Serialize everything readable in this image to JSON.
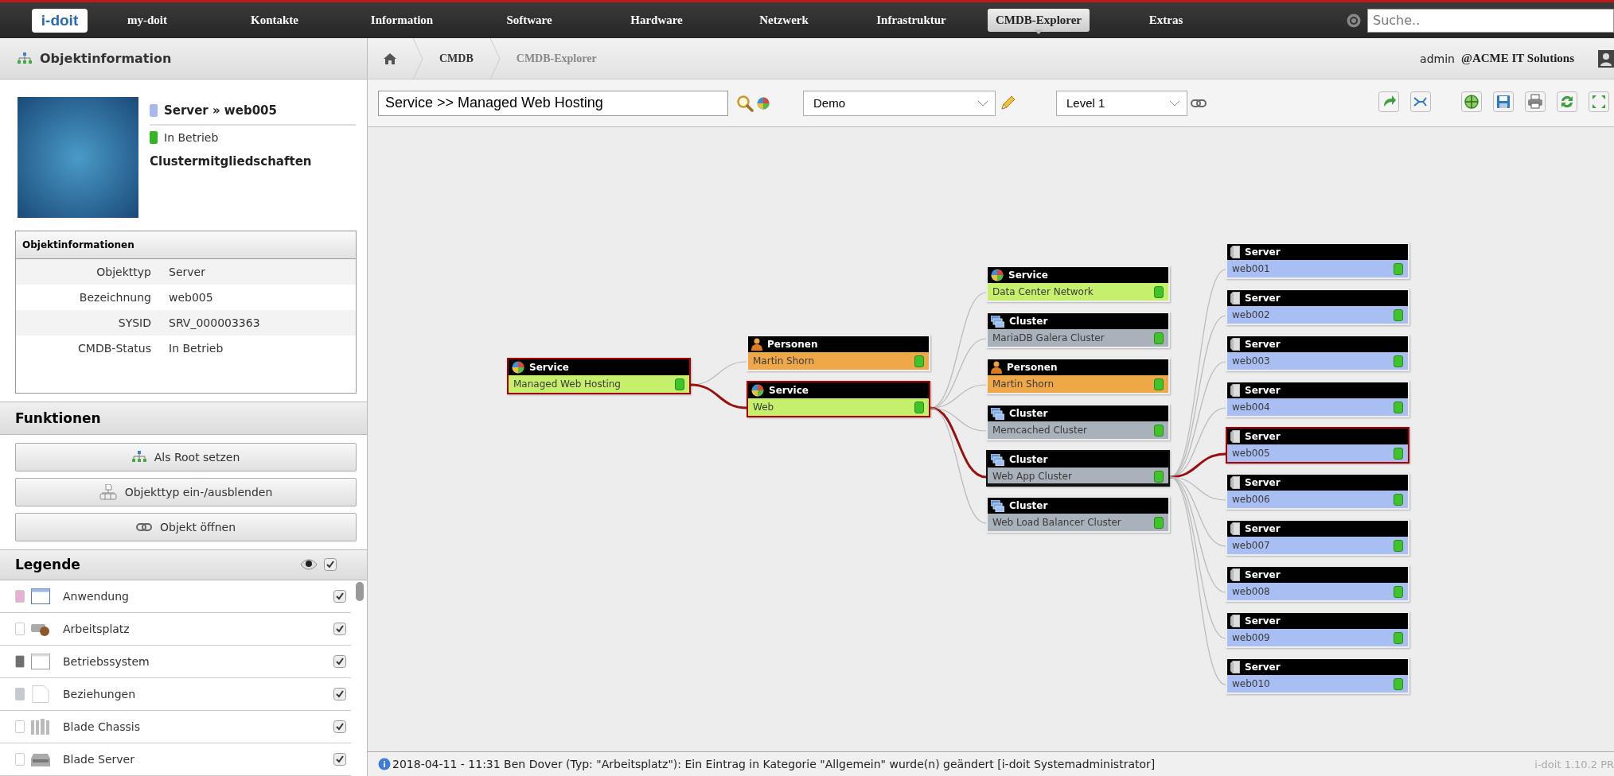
{
  "nav": {
    "logo": "i-doit",
    "items": [
      {
        "label": "my-doit",
        "selected": false
      },
      {
        "label": "Kontakte",
        "selected": false
      },
      {
        "label": "Information",
        "selected": false
      },
      {
        "label": "Software",
        "selected": false
      },
      {
        "label": "Hardware",
        "selected": false
      },
      {
        "label": "Netzwerk",
        "selected": false
      },
      {
        "label": "Infrastruktur",
        "selected": false
      },
      {
        "label": "CMDB-Explorer",
        "selected": true
      },
      {
        "label": "Extras",
        "selected": false
      }
    ],
    "search": {
      "placeholder": "Suche.."
    }
  },
  "left_panel": {
    "title": "Objektinformation",
    "object": {
      "title": "Server » web005",
      "status": "In Betrieb",
      "section": "Clustermitgliedschaften"
    },
    "info_table": {
      "title": "Objektinformationen",
      "rows": [
        {
          "label": "Objekttyp",
          "value": "Server"
        },
        {
          "label": "Bezeichnung",
          "value": "web005"
        },
        {
          "label": "SYSID",
          "value": "SRV_000003363"
        },
        {
          "label": "CMDB-Status",
          "value": "In Betrieb"
        }
      ]
    },
    "functions": {
      "title": "Funktionen",
      "buttons": [
        {
          "label": "Als Root setzen",
          "kind": "root"
        },
        {
          "label": "Objekttyp ein-/ausblenden",
          "kind": "toggle"
        },
        {
          "label": "Objekt öffnen",
          "kind": "open"
        }
      ]
    },
    "legend": {
      "title": "Legende",
      "all_checked": true,
      "items": [
        {
          "label": "Anwendung",
          "kind": "application",
          "color": "#e6b0d2",
          "checked": true
        },
        {
          "label": "Arbeitsplatz",
          "kind": "workstation",
          "color": "#ffffff",
          "checked": true
        },
        {
          "label": "Betriebssystem",
          "kind": "os",
          "color": "#6e6e6e",
          "checked": true
        },
        {
          "label": "Beziehungen",
          "kind": "relation",
          "color": "#c5c9d2",
          "checked": true
        },
        {
          "label": "Blade Chassis",
          "kind": "chassis",
          "color": "#ffffff",
          "checked": true
        },
        {
          "label": "Blade Server",
          "kind": "blade",
          "color": "#ffffff",
          "checked": true
        }
      ]
    }
  },
  "breadcrumb": {
    "items": [
      "CMDB",
      "CMDB-Explorer"
    ],
    "user": "admin",
    "tenant": "@ACME IT Solutions"
  },
  "toolbar": {
    "object_field": {
      "value": "Service >> Managed Web Hosting"
    },
    "profile_select": {
      "value": "Demo"
    },
    "level_select": {
      "value": "Level 1"
    }
  },
  "graph": {
    "root": {
      "kind": "service",
      "type_label": "Service",
      "name": "Managed Web Hosting",
      "highlighted": true,
      "focused": false,
      "children": [
        {
          "kind": "person",
          "type_label": "Personen",
          "name": "Martin Shorn",
          "highlighted": false,
          "focused": false
        },
        {
          "kind": "service",
          "type_label": "Service",
          "name": "Web",
          "highlighted": true,
          "focused": false,
          "children": [
            {
              "kind": "service",
              "type_label": "Service",
              "name": "Data Center Network",
              "highlighted": false,
              "focused": false
            },
            {
              "kind": "cluster",
              "type_label": "Cluster",
              "name": "MariaDB Galera Cluster",
              "highlighted": false,
              "focused": false
            },
            {
              "kind": "person",
              "type_label": "Personen",
              "name": "Martin Shorn",
              "highlighted": false,
              "focused": false
            },
            {
              "kind": "cluster",
              "type_label": "Cluster",
              "name": "Memcached Cluster",
              "highlighted": false,
              "focused": false
            },
            {
              "kind": "cluster",
              "type_label": "Cluster",
              "name": "Web App Cluster",
              "highlighted": false,
              "focused": true,
              "children": [
                {
                  "kind": "server",
                  "type_label": "Server",
                  "name": "web001",
                  "highlighted": false,
                  "focused": false
                },
                {
                  "kind": "server",
                  "type_label": "Server",
                  "name": "web002",
                  "highlighted": false,
                  "focused": false
                },
                {
                  "kind": "server",
                  "type_label": "Server",
                  "name": "web003",
                  "highlighted": false,
                  "focused": false
                },
                {
                  "kind": "server",
                  "type_label": "Server",
                  "name": "web004",
                  "highlighted": false,
                  "focused": false
                },
                {
                  "kind": "server",
                  "type_label": "Server",
                  "name": "web005",
                  "highlighted": true,
                  "focused": false
                },
                {
                  "kind": "server",
                  "type_label": "Server",
                  "name": "web006",
                  "highlighted": false,
                  "focused": false
                },
                {
                  "kind": "server",
                  "type_label": "Server",
                  "name": "web007",
                  "highlighted": false,
                  "focused": false
                },
                {
                  "kind": "server",
                  "type_label": "Server",
                  "name": "web008",
                  "highlighted": false,
                  "focused": false
                },
                {
                  "kind": "server",
                  "type_label": "Server",
                  "name": "web009",
                  "highlighted": false,
                  "focused": false
                },
                {
                  "kind": "server",
                  "type_label": "Server",
                  "name": "web010",
                  "highlighted": false,
                  "focused": false
                }
              ]
            },
            {
              "kind": "cluster",
              "type_label": "Cluster",
              "name": "Web Load Balancer Cluster",
              "highlighted": false,
              "focused": false
            }
          ]
        }
      ]
    }
  },
  "status_bar": {
    "message": "2018-04-11 - 11:31 Ben Dover (Typ: \"Arbeitsplatz\"): Ein Eintrag in Kategorie \"Allgemein\" wurde(n) geändert [i-doit Systemadministrator]",
    "version": "i-doit 1.10.2 PR"
  }
}
